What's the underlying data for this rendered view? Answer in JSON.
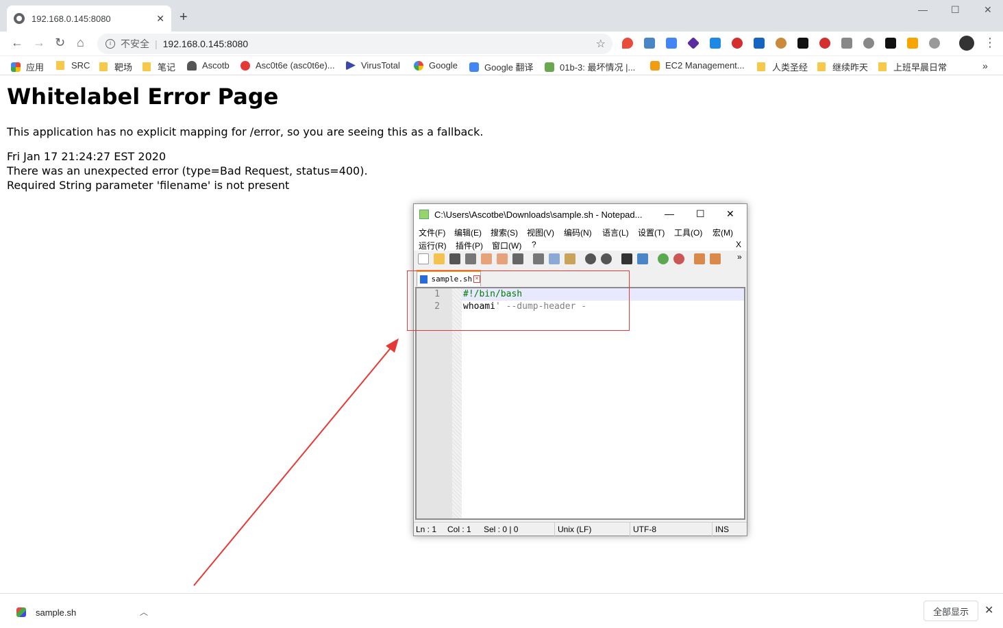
{
  "browser": {
    "tab_title": "192.168.0.145:8080",
    "tab_close": "✕",
    "new_tab": "+",
    "insecure_label": "不安全",
    "url": "192.168.0.145:8080"
  },
  "bookmarks": [
    {
      "label": "应用",
      "kind": "apps"
    },
    {
      "label": "SRC",
      "kind": "folder"
    },
    {
      "label": "靶场",
      "kind": "folder"
    },
    {
      "label": "笔记",
      "kind": "folder"
    },
    {
      "label": "Ascotb",
      "kind": "site"
    },
    {
      "label": "Asc0t6e (asc0t6e)...",
      "kind": "site"
    },
    {
      "label": "VirusTotal",
      "kind": "site"
    },
    {
      "label": "Google",
      "kind": "site"
    },
    {
      "label": "Google 翻译",
      "kind": "site"
    },
    {
      "label": "01b-3: 最坏情况 |...",
      "kind": "site"
    },
    {
      "label": "EC2 Management...",
      "kind": "site"
    },
    {
      "label": "人类圣经",
      "kind": "folder"
    },
    {
      "label": "继续昨天",
      "kind": "folder"
    },
    {
      "label": "上班早晨日常",
      "kind": "folder"
    }
  ],
  "page": {
    "heading": "Whitelabel Error Page",
    "fallback_msg": "This application has no explicit mapping for /error, so you are seeing this as a fallback.",
    "timestamp": "Fri Jan 17 21:24:27 EST 2020",
    "error_line": "There was an unexpected error (type=Bad Request, status=400).",
    "param_line": "Required String parameter 'filename' is not present"
  },
  "notepad": {
    "title": "C:\\Users\\Ascotbe\\Downloads\\sample.sh - Notepad...",
    "menu_row1": [
      "文件(F)",
      "编辑(E)",
      "搜索(S)",
      "视图(V)",
      "编码(N)",
      "语言(L)",
      "设置(T)",
      "工具(O)",
      "宏(M)"
    ],
    "menu_row2": [
      "运行(R)",
      "插件(P)",
      "窗口(W)",
      "?"
    ],
    "menu_close": "X",
    "tab_label": "sample.sh",
    "lines": [
      {
        "num": "1",
        "text_a": "#!/bin/bash",
        "text_b": ""
      },
      {
        "num": "2",
        "text_a": "whoami",
        "text_b": "' --dump-header -"
      }
    ],
    "status": {
      "ln": "Ln : 1",
      "col": "Col : 1",
      "sel": "Sel : 0 | 0",
      "eol": "Unix (LF)",
      "enc": "UTF-8",
      "mode": "INS"
    },
    "toolbar_more": "»"
  },
  "download": {
    "file": "sample.sh",
    "show_all": "全部显示",
    "close": "✕"
  },
  "colors": {
    "annotation_red": "#e53935",
    "chrome_bg": "#dee1e6"
  }
}
